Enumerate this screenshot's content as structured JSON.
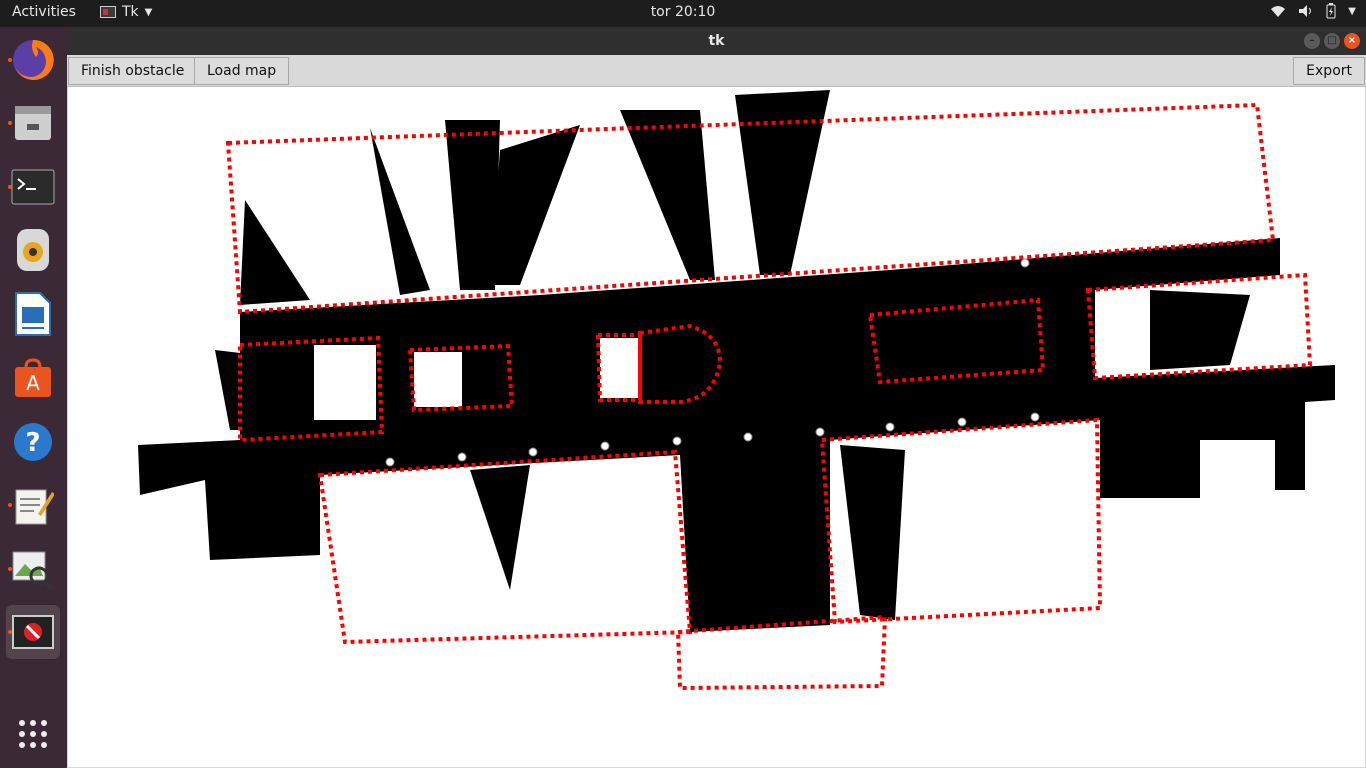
{
  "topbar": {
    "activities": "Activities",
    "app_name": "Tk",
    "clock": "tor 20:10"
  },
  "dock": {
    "items": [
      {
        "name": "firefox",
        "icon": "firefox-icon",
        "running": true
      },
      {
        "name": "files",
        "icon": "files-icon",
        "running": true
      },
      {
        "name": "terminal",
        "icon": "terminal-icon",
        "running": true
      },
      {
        "name": "rhythmbox",
        "icon": "speaker-icon",
        "running": false
      },
      {
        "name": "writer",
        "icon": "document-icon",
        "running": false
      },
      {
        "name": "software",
        "icon": "software-center-icon",
        "running": false
      },
      {
        "name": "help",
        "icon": "help-icon",
        "running": false
      },
      {
        "name": "text-editor",
        "icon": "text-editor-icon",
        "running": true
      },
      {
        "name": "image-viewer",
        "icon": "image-viewer-icon",
        "running": true
      },
      {
        "name": "tk-app",
        "icon": "tk-window-icon",
        "running": true,
        "active": true
      }
    ],
    "show_apps_icon": "app-grid-icon"
  },
  "window": {
    "title": "tk",
    "toolbar": {
      "finish_obstacle": "Finish obstacle",
      "load_map": "Load map",
      "export": "Export"
    }
  },
  "colors": {
    "accent": "#e95420",
    "obstacle_outline": "#ff0000",
    "map_fill": "#000000"
  }
}
